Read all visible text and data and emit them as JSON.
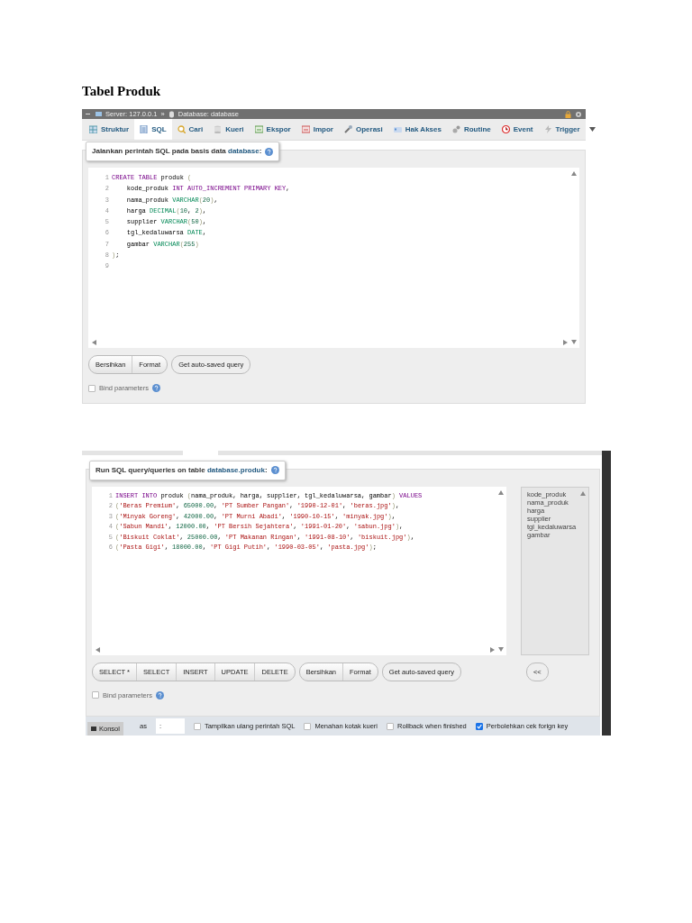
{
  "heading": "Tabel Produk",
  "database_sql_panel": {
    "breadcrumb": [
      {
        "text": "Server: 127.0.0.1"
      },
      {
        "text": "Database: database"
      }
    ],
    "separator": "»",
    "tabs": [
      {
        "label": "Struktur",
        "selected": false
      },
      {
        "label": "SQL",
        "selected": true
      },
      {
        "label": "Cari",
        "selected": false
      },
      {
        "label": "Kueri",
        "selected": false
      },
      {
        "label": "Ekspor",
        "selected": false
      },
      {
        "label": "Impor",
        "selected": false
      },
      {
        "label": "Operasi",
        "selected": false
      },
      {
        "label": "Hak Akses",
        "selected": false
      },
      {
        "label": "Routine",
        "selected": false
      },
      {
        "label": "Event",
        "selected": false
      },
      {
        "label": "Trigger",
        "selected": false
      }
    ],
    "legend": {
      "text": "Jalankan perintah SQL pada basis data ",
      "link": "database",
      "suffix": ":"
    },
    "editor_lines": [
      {
        "number": "1",
        "tokens": [
          {
            "kind": "kw",
            "t": "CREATE TABLE"
          },
          {
            "kind": "plain",
            "t": " produk "
          },
          {
            "kind": "paren",
            "t": "("
          }
        ]
      },
      {
        "number": "2",
        "tokens": [
          {
            "kind": "plain",
            "t": "    kode_produk "
          },
          {
            "kind": "kw",
            "t": "INT AUTO_INCREMENT PRIMARY KEY"
          },
          {
            "kind": "plain",
            "t": ","
          }
        ]
      },
      {
        "number": "3",
        "tokens": [
          {
            "kind": "plain",
            "t": "    nama_produk "
          },
          {
            "kind": "type",
            "t": "VARCHAR"
          },
          {
            "kind": "paren",
            "t": "("
          },
          {
            "kind": "num",
            "t": "20"
          },
          {
            "kind": "paren",
            "t": ")"
          },
          {
            "kind": "plain",
            "t": ","
          }
        ]
      },
      {
        "number": "4",
        "tokens": [
          {
            "kind": "plain",
            "t": "    harga "
          },
          {
            "kind": "type",
            "t": "DECIMAL"
          },
          {
            "kind": "paren",
            "t": "("
          },
          {
            "kind": "num",
            "t": "10"
          },
          {
            "kind": "plain",
            "t": ", "
          },
          {
            "kind": "num",
            "t": "2"
          },
          {
            "kind": "paren",
            "t": ")"
          },
          {
            "kind": "plain",
            "t": ","
          }
        ]
      },
      {
        "number": "5",
        "tokens": [
          {
            "kind": "plain",
            "t": "    supplier "
          },
          {
            "kind": "type",
            "t": "VARCHAR"
          },
          {
            "kind": "paren",
            "t": "("
          },
          {
            "kind": "num",
            "t": "50"
          },
          {
            "kind": "paren",
            "t": ")"
          },
          {
            "kind": "plain",
            "t": ","
          }
        ]
      },
      {
        "number": "6",
        "tokens": [
          {
            "kind": "plain",
            "t": "    tgl_kedaluwarsa "
          },
          {
            "kind": "type",
            "t": "DATE"
          },
          {
            "kind": "plain",
            "t": ","
          }
        ]
      },
      {
        "number": "7",
        "tokens": [
          {
            "kind": "plain",
            "t": "    gambar "
          },
          {
            "kind": "type",
            "t": "VARCHAR"
          },
          {
            "kind": "paren",
            "t": "("
          },
          {
            "kind": "num",
            "t": "255"
          },
          {
            "kind": "paren",
            "t": ")"
          }
        ]
      },
      {
        "number": "8",
        "tokens": [
          {
            "kind": "paren",
            "t": ")"
          },
          {
            "kind": "plain",
            "t": ";"
          }
        ]
      },
      {
        "number": "9"
      }
    ],
    "button_groups": [
      [
        "Bersihkan",
        "Format"
      ],
      [
        "Get auto-saved query"
      ]
    ],
    "bind_parameters": {
      "label": "Bind parameters",
      "checked": false
    }
  },
  "table_sql_panel": {
    "legend": {
      "text": "Run SQL query/queries on table ",
      "link": "database.produk",
      "suffix": ":"
    },
    "editor_lines": [
      {
        "number": "1",
        "tokens": [
          {
            "kind": "kw",
            "t": "INSERT INTO"
          },
          {
            "kind": "plain",
            "t": " produk "
          },
          {
            "kind": "paren",
            "t": "("
          },
          {
            "kind": "plain",
            "t": "nama_produk, harga, supplier, tgl_kedaluwarsa, gambar"
          },
          {
            "kind": "paren",
            "t": ")"
          },
          {
            "kind": "kw",
            "t": " VALUES"
          }
        ]
      },
      {
        "number": "2",
        "tokens": [
          {
            "kind": "paren",
            "t": "("
          },
          {
            "kind": "str",
            "t": "'Beras Premium'"
          },
          {
            "kind": "plain",
            "t": ", "
          },
          {
            "kind": "num",
            "t": "65000.00"
          },
          {
            "kind": "plain",
            "t": ", "
          },
          {
            "kind": "str",
            "t": "'PT Sumber Pangan'"
          },
          {
            "kind": "plain",
            "t": ", "
          },
          {
            "kind": "str",
            "t": "'1990-12-01'"
          },
          {
            "kind": "plain",
            "t": ", "
          },
          {
            "kind": "str",
            "t": "'beras.jpg'"
          },
          {
            "kind": "paren",
            "t": ")"
          },
          {
            "kind": "plain",
            "t": ","
          }
        ]
      },
      {
        "number": "3",
        "tokens": [
          {
            "kind": "paren",
            "t": "("
          },
          {
            "kind": "str",
            "t": "'Minyak Goreng'"
          },
          {
            "kind": "plain",
            "t": ", "
          },
          {
            "kind": "num",
            "t": "42000.00"
          },
          {
            "kind": "plain",
            "t": ", "
          },
          {
            "kind": "str",
            "t": "'PT Murni Abadi'"
          },
          {
            "kind": "plain",
            "t": ", "
          },
          {
            "kind": "str",
            "t": "'1990-10-15'"
          },
          {
            "kind": "plain",
            "t": ", "
          },
          {
            "kind": "str",
            "t": "'minyak.jpg'"
          },
          {
            "kind": "paren",
            "t": ")"
          },
          {
            "kind": "plain",
            "t": ","
          }
        ]
      },
      {
        "number": "4",
        "tokens": [
          {
            "kind": "paren",
            "t": "("
          },
          {
            "kind": "str",
            "t": "'Sabun Mandi'"
          },
          {
            "kind": "plain",
            "t": ", "
          },
          {
            "kind": "num",
            "t": "12000.00"
          },
          {
            "kind": "plain",
            "t": ", "
          },
          {
            "kind": "str",
            "t": "'PT Bersih Sejahtera'"
          },
          {
            "kind": "plain",
            "t": ", "
          },
          {
            "kind": "str",
            "t": "'1991-01-20'"
          },
          {
            "kind": "plain",
            "t": ", "
          },
          {
            "kind": "str",
            "t": "'sabun.jpg'"
          },
          {
            "kind": "paren",
            "t": ")"
          },
          {
            "kind": "plain",
            "t": ","
          }
        ]
      },
      {
        "number": "5",
        "tokens": [
          {
            "kind": "paren",
            "t": "("
          },
          {
            "kind": "str",
            "t": "'Biskuit Coklat'"
          },
          {
            "kind": "plain",
            "t": ", "
          },
          {
            "kind": "num",
            "t": "25000.00"
          },
          {
            "kind": "plain",
            "t": ", "
          },
          {
            "kind": "str",
            "t": "'PT Makanan Ringan'"
          },
          {
            "kind": "plain",
            "t": ", "
          },
          {
            "kind": "str",
            "t": "'1991-08-10'"
          },
          {
            "kind": "plain",
            "t": ", "
          },
          {
            "kind": "str",
            "t": "'biskuit.jpg'"
          },
          {
            "kind": "paren",
            "t": ")"
          },
          {
            "kind": "plain",
            "t": ","
          }
        ]
      },
      {
        "number": "6",
        "tokens": [
          {
            "kind": "paren",
            "t": "("
          },
          {
            "kind": "str",
            "t": "'Pasta Gigi'"
          },
          {
            "kind": "plain",
            "t": ", "
          },
          {
            "kind": "num",
            "t": "18000.00"
          },
          {
            "kind": "plain",
            "t": ", "
          },
          {
            "kind": "str",
            "t": "'PT Gigi Putih'"
          },
          {
            "kind": "plain",
            "t": ", "
          },
          {
            "kind": "str",
            "t": "'1990-03-05'"
          },
          {
            "kind": "plain",
            "t": ", "
          },
          {
            "kind": "str",
            "t": "'pasta.jpg'"
          },
          {
            "kind": "paren",
            "t": ")"
          },
          {
            "kind": "plain",
            "t": ";"
          }
        ]
      }
    ],
    "columns": [
      "kode_produk",
      "nama_produk",
      "harga",
      "supplier",
      "tgl_kedaluwarsa",
      "gambar"
    ],
    "button_groups": [
      [
        "SELECT *",
        "SELECT",
        "INSERT",
        "UPDATE",
        "DELETE"
      ],
      [
        "Bersihkan",
        "Format"
      ],
      [
        "Get auto-saved query"
      ]
    ],
    "collapse_button": "<<",
    "bind_parameters": {
      "label": "Bind parameters",
      "checked": false
    },
    "console": {
      "button": "Konsol",
      "partial_label": "as",
      "field_value": ":",
      "options": [
        {
          "label": "Tampilkan ulang perintah SQL",
          "checked": false
        },
        {
          "label": "Menahan kotak kueri",
          "checked": false
        },
        {
          "label": "Rollback when finished",
          "checked": false
        },
        {
          "label": "Perbolehkan cek forign key",
          "checked": true
        }
      ]
    }
  }
}
